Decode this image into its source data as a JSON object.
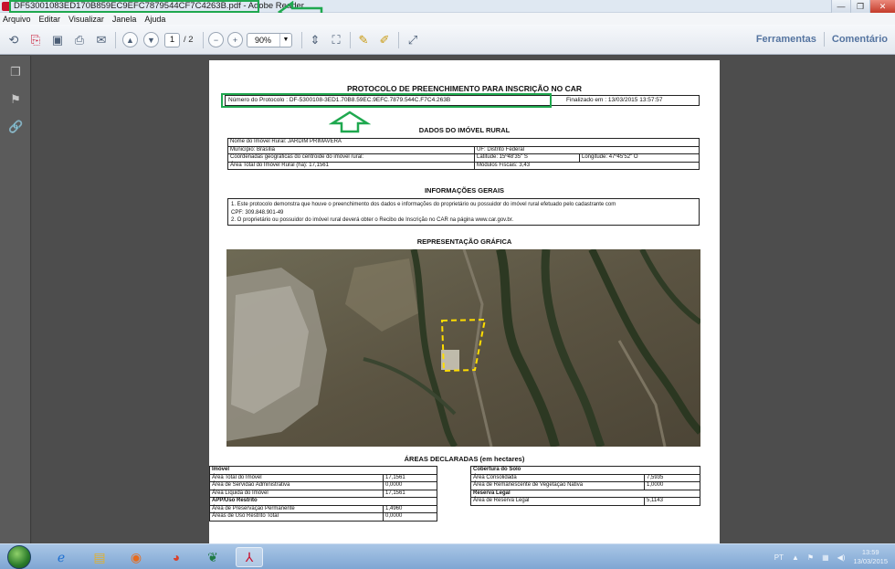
{
  "window": {
    "title": "DF53001083ED170B859EC9EFC7879544CF7C4263B.pdf - Adobe Reader",
    "buttons": [
      "—",
      "❐",
      "✕"
    ]
  },
  "menu": [
    "Arquivo",
    "Editar",
    "Visualizar",
    "Janela",
    "Ajuda"
  ],
  "toolbar": {
    "page_current": "1",
    "page_total": "/ 2",
    "zoom": "90%",
    "tools_label": "Ferramentas",
    "comment_label": "Comentário"
  },
  "document": {
    "title": "PROTOCOLO DE PREENCHIMENTO PARA INSCRIÇÃO NO CAR",
    "protocol_number": "Número do Protocolo : DF-5300108-3ED1.70B8.59EC.9EFC.7879.544C.F7C4.263B",
    "finalized": "Finalizado em : 13/03/2015 13:57:57",
    "section_rural": "DADOS DO IMÓVEL RURAL",
    "rural": {
      "nome": "Nome do Imóvel Rural: JARDIM PRIMAVERA",
      "municipio": "Município: Brasília",
      "uf": "UF: Distrito Federal",
      "coordenadas": "Coordenadas geográficas do centroide do imóvel rural:",
      "latitude": "Latitude: 15º48'35\" S",
      "longitude": "Longitude: 47º45'52\" O",
      "area_total": "Área Total do Imóvel Rural (ha): 17,1561",
      "modulos": "Módulos Fiscais: 3,43"
    },
    "section_info": "INFORMAÇÕES GERAIS",
    "info_line1": "1. Este protocolo demonstra que houve o preenchimento dos dados e informações do proprietário ou possuidor do imóvel rural efetuado pelo cadastrante com",
    "info_line2": "CPF: 309.848.901-49",
    "info_line3": "2. O proprietário ou possuidor do imóvel rural deverá obter o Recibo de Inscrição no CAR na página www.car.gov.br.",
    "section_graphic": "REPRESENTAÇÃO GRÁFICA",
    "section_areas": "ÁREAS DECLARADAS (em hectares)",
    "areas_left": {
      "header": "Imóvel",
      "rows": [
        [
          "Área Total do Imóvel",
          "17,1561"
        ],
        [
          "Área de Servidão Administrativa",
          "0,0000"
        ],
        [
          "Área Líquida do Imóvel",
          "17,1561"
        ]
      ],
      "header2": "APP/Uso Restrito",
      "rows2": [
        [
          "Área de Preservação Permanente",
          "1,4960"
        ],
        [
          "Áreas de Uso Restrito Total",
          "0,0000"
        ]
      ]
    },
    "areas_right": {
      "header": "Cobertura do Solo",
      "rows": [
        [
          "Área Consolidada",
          "7,5935"
        ],
        [
          "Área de Remanescente de Vegetação Nativa",
          "1,0000"
        ]
      ],
      "header2": "Reserva Legal",
      "rows2": [
        [
          "Área de Reserva Legal",
          "5,1143"
        ]
      ]
    }
  },
  "taskbar": {
    "lang": "PT",
    "time": "13:59",
    "date": "13/03/2015"
  },
  "colors": {
    "highlight": "#1fa84f",
    "link_blue": "#5574a0",
    "taskbar": "#7fa6d3"
  }
}
